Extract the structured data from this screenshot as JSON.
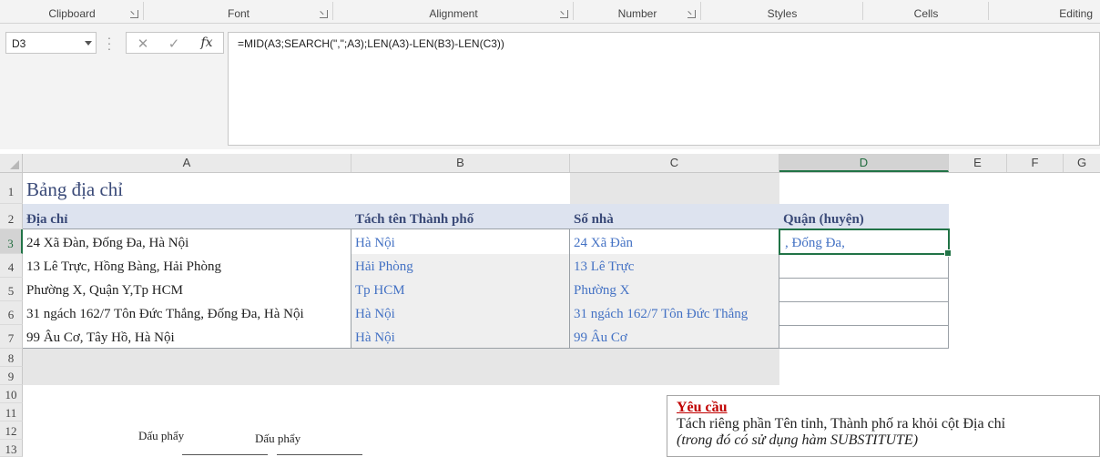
{
  "ribbon": {
    "groups": [
      {
        "label": "Clipboard"
      },
      {
        "label": "Font"
      },
      {
        "label": "Alignment"
      },
      {
        "label": "Number"
      },
      {
        "label": "Styles"
      },
      {
        "label": "Cells"
      },
      {
        "label": "Editing"
      }
    ]
  },
  "formula_bar": {
    "name_box": "D3",
    "cancel_icon": "✕",
    "enter_icon": "✓",
    "fx_label": "fx",
    "formula": "=MID(A3;SEARCH(\",\";A3);LEN(A3)-LEN(B3)-LEN(C3))"
  },
  "columns": [
    "A",
    "B",
    "C",
    "D",
    "E",
    "F",
    "G"
  ],
  "rows": [
    "1",
    "2",
    "3",
    "4",
    "5",
    "6",
    "7",
    "8",
    "9",
    "10",
    "11",
    "12",
    "13"
  ],
  "sheet": {
    "title": "Bảng địa chỉ",
    "headers": {
      "a": "Địa chỉ",
      "b": "Tách tên Thành phố",
      "c": "Số nhà",
      "d": "Quận (huyện)"
    },
    "data_rows": [
      {
        "a": "24 Xã Đàn, Đống Đa, Hà Nội",
        "b": "Hà Nội",
        "c": "24 Xã Đàn",
        "d": ", Đống Đa,"
      },
      {
        "a": "13 Lê Trực, Hồng Bàng, Hải Phòng",
        "b": "Hải Phòng",
        "c": "13 Lê Trực",
        "d": ""
      },
      {
        "a": "Phường X, Quận Y,Tp HCM",
        "b": "Tp HCM",
        "c": "Phường X",
        "d": ""
      },
      {
        "a": "31 ngách 162/7 Tôn Đức Thắng, Đống Đa, Hà Nội",
        "b": "Hà Nội",
        "c": "31 ngách 162/7 Tôn Đức Thắng",
        "d": ""
      },
      {
        "a": "99 Âu Cơ, Tây Hồ,  Hà Nội",
        "b": "Hà Nội",
        "c": "99 Âu Cơ",
        "d": ""
      }
    ],
    "callouts": [
      "Dấu phẩy",
      "Dấu phẩy"
    ]
  },
  "note": {
    "title": "Yêu cầu",
    "line1": "Tách riêng phần Tên tỉnh, Thành phố ra khỏi cột Địa chỉ",
    "line2": "(trong đó có sử dụng hàm SUBSTITUTE)"
  },
  "colors": {
    "accent": "#217346",
    "link_blue": "#4472c4",
    "header_fill": "#dde3ef",
    "note_title": "#c00000"
  }
}
